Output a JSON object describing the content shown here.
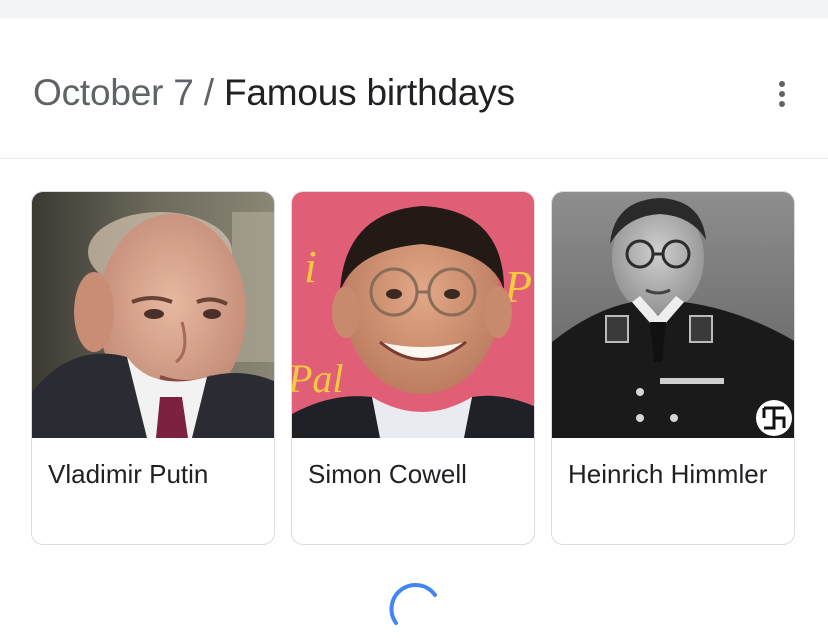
{
  "header": {
    "date": "October 7",
    "separator": "/",
    "title": "Famous birthdays"
  },
  "menu": {
    "icon": "more-vert-icon"
  },
  "people": [
    {
      "name": "Vladimir Putin"
    },
    {
      "name": "Simon Cowell"
    },
    {
      "name": "Heinrich Himmler"
    }
  ],
  "loading": {
    "icon": "loading-spinner-icon"
  },
  "colors": {
    "spinner": "#4285f4",
    "text_primary": "#202124",
    "text_secondary": "#5f6368",
    "card_border": "#dadce0"
  }
}
